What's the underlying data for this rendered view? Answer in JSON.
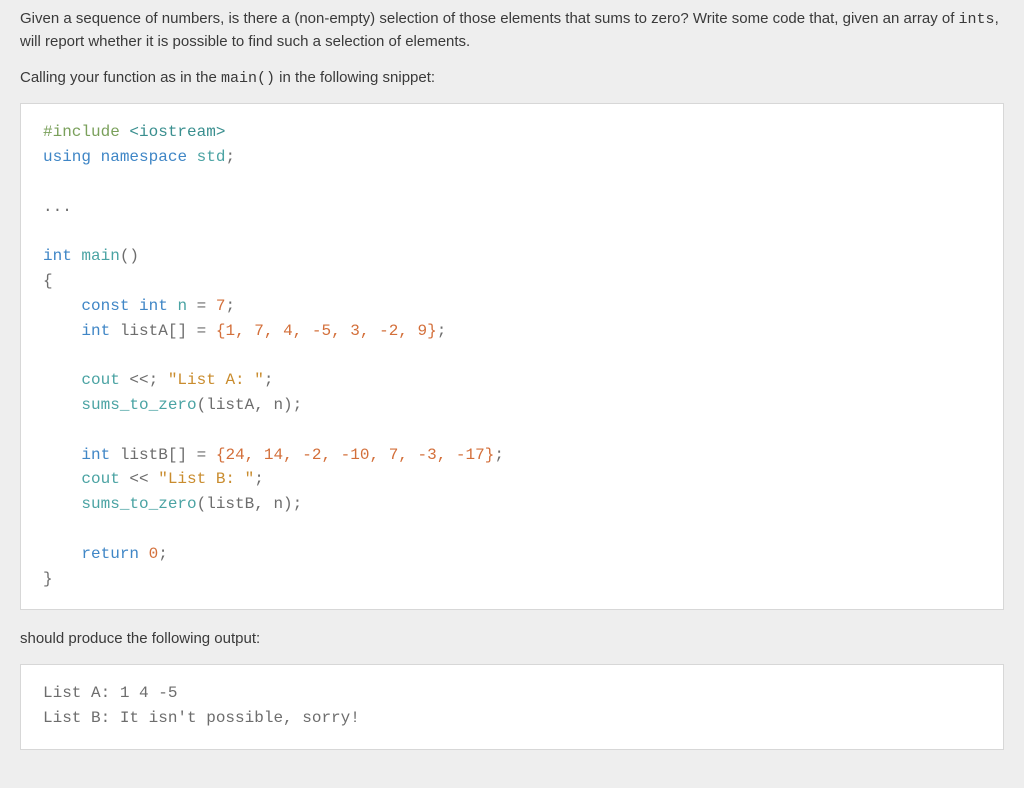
{
  "intro": {
    "part1": "Given a sequence of numbers, is there a (non-empty) selection of those elements that sums to zero? Write some code that, given an array of ",
    "code1": "ints",
    "part2": ", will report whether it is possible to find such a selection of elements."
  },
  "call_line": {
    "part1": "Calling your function as in the ",
    "code1": "main()",
    "part2": " in the following snippet:"
  },
  "code": {
    "include_hash": "#include ",
    "include_target": "<iostream>",
    "using": "using",
    "namespace": "namespace",
    "std": "std",
    "ellipsis": "...",
    "int_kw": "int",
    "main_name": "main",
    "parens": "()",
    "lbrace": "{",
    "const_kw": "const",
    "n_name": "n",
    "eq": " = ",
    "n_val": "7",
    "semi": ";",
    "listA_name": "listA",
    "brackets": "[]",
    "listA_vals": "{1, 7, 4, -5, 3, -2, 9}",
    "cout": "cout",
    "lshift_semi": " <<; ",
    "lshift": " << ",
    "strA": "\"List A: \"",
    "sums_fn": "sums_to_zero",
    "callA_args": "(listA, n)",
    "listB_name": "listB",
    "listB_vals": "{24, 14, -2, -10, 7, -3, -17}",
    "strB": "\"List B: \"",
    "callB_args": "(listB, n)",
    "return_kw": "return",
    "zero": "0",
    "rbrace": "}"
  },
  "outro": "should produce the following output:",
  "output": {
    "line1": "List A: 1 4 -5",
    "line2": "List B: It isn't possible, sorry!"
  }
}
